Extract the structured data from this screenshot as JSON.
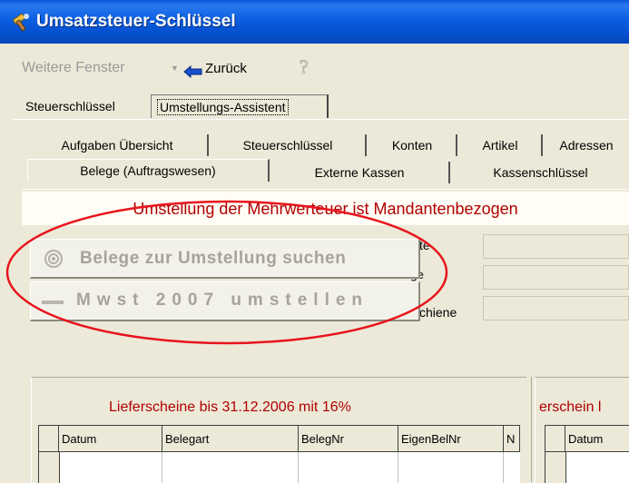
{
  "window": {
    "title": "Umsatzsteuer-Schlüssel"
  },
  "toolbar": {
    "weitere_fenster": "Weitere Fenster",
    "dropdown_arrow": "▼",
    "back_label": "Zurück",
    "help_icon": "question-icon"
  },
  "top_tabs": [
    "Steuerschlüssel",
    "Umstellungs-Assistent"
  ],
  "inner_tabs_row1": [
    "Aufgaben Übersicht",
    "Steuerschlüssel",
    "Konten",
    "Artikel",
    "Adressen"
  ],
  "inner_tabs_row2": [
    "Belege (Auftragswesen)",
    "Externe Kassen",
    "Kassenschlüssel"
  ],
  "banner": {
    "text": "Umstellung der Mehrwerteuer ist Mandantenbezogen"
  },
  "buttons": {
    "search": "Belege zur Umstellung suchen",
    "convert": "Mwst 2007 umstellen"
  },
  "side_labels": [
    "te",
    "Summe Aufträge",
    "chiene"
  ],
  "group_left": {
    "title": "Lieferscheine bis 31.12.2006  mit 16%",
    "columns": [
      "Datum",
      "Belegart",
      "BelegNr",
      "EigenBelNr",
      "N"
    ]
  },
  "group_right": {
    "title": "erschein l",
    "columns": [
      "Datum"
    ]
  },
  "colors": {
    "title_bar": "#0550cf",
    "accent_red": "#b00000",
    "window_bg": "#ece9d8"
  }
}
